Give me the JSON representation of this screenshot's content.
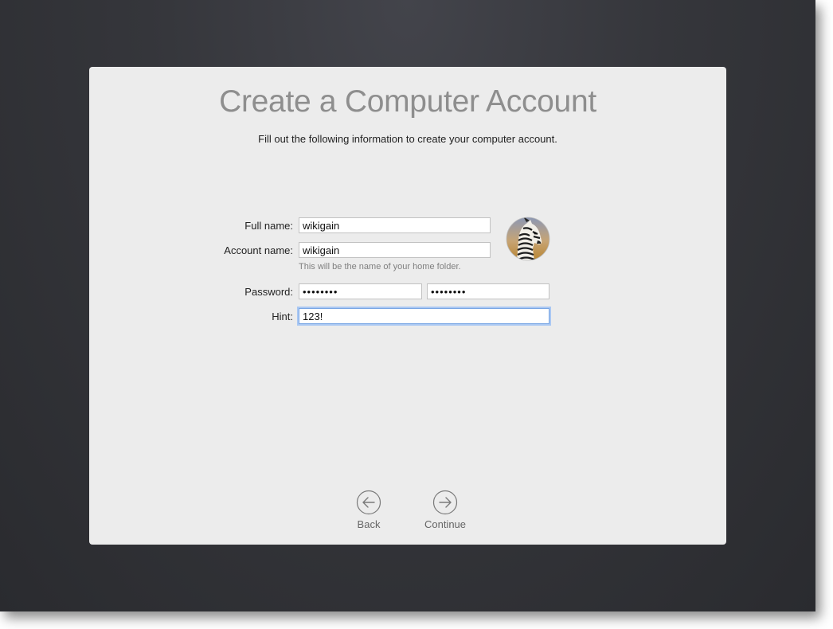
{
  "window": {
    "title": "Create a Computer Account",
    "subtitle": "Fill out the following information to create your computer account."
  },
  "form": {
    "full_name": {
      "label": "Full name:",
      "value": "wikigain"
    },
    "account_name": {
      "label": "Account name:",
      "value": "wikigain",
      "help": "This will be the name of your home folder."
    },
    "password": {
      "label": "Password:",
      "value": "••••••••",
      "verify_value": "••••••••"
    },
    "hint": {
      "label": "Hint:",
      "value": "123!"
    }
  },
  "avatar": {
    "icon": "zebra-avatar-icon"
  },
  "nav": {
    "back_label": "Back",
    "continue_label": "Continue"
  },
  "colors": {
    "focus_ring": "#aac8f3",
    "panel_bg": "#ececec",
    "desktop_bg": "#35363b"
  }
}
